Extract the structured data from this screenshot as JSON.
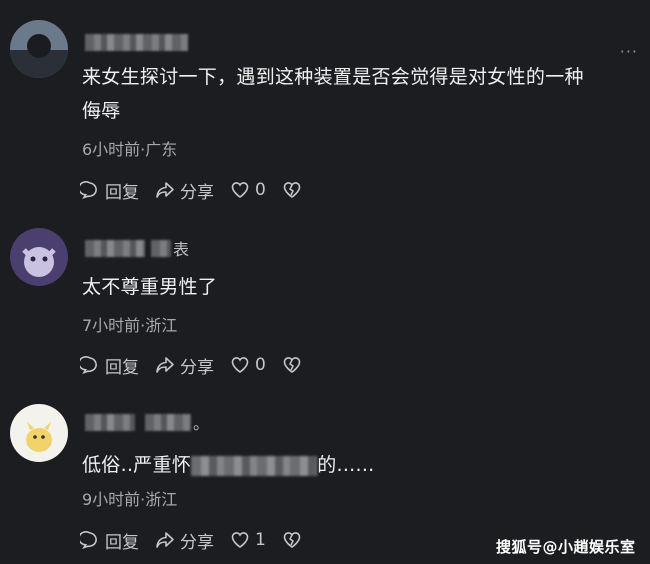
{
  "comments": [
    {
      "text_lines": [
        "来女生探讨一下，遇到这种装置是否会觉得是对女性的一种",
        "侮辱"
      ],
      "meta": "6小时前·广东",
      "actions": {
        "reply": "回复",
        "share": "分享",
        "likes": "0"
      }
    },
    {
      "name_tail": "表",
      "text_lines": [
        "太不尊重男性了"
      ],
      "meta": "7小时前·浙江",
      "actions": {
        "reply": "回复",
        "share": "分享",
        "likes": "0"
      }
    },
    {
      "name_tail": "。",
      "text_prefix": "低俗..严重怀",
      "text_suffix": "的......",
      "meta": "9小时前·浙江",
      "actions": {
        "reply": "回复",
        "share": "分享",
        "likes": "1"
      }
    }
  ],
  "more_menu": "···",
  "watermark": "搜狐号@小趙娱乐室",
  "icons": [
    "comment-icon",
    "share-arrow-icon",
    "heart-icon",
    "broken-heart-icon",
    "more-dots-icon"
  ]
}
